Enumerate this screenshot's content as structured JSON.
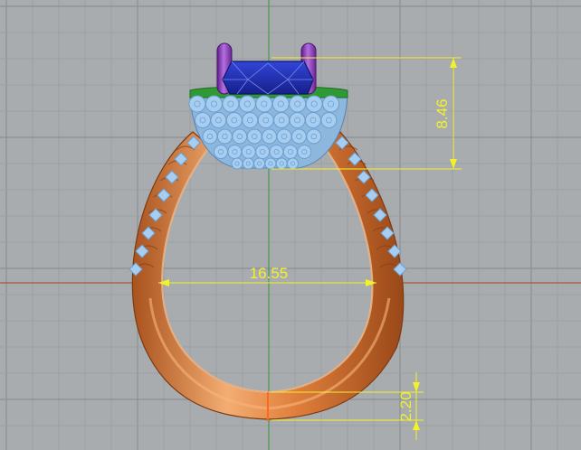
{
  "viewport": {
    "background": "#a9acaf",
    "grid_minor_color": "#9da0a3",
    "grid_major_color": "#8c8f92",
    "axis_y_color": "#3a9a3a",
    "axis_x_color": "#a4451f"
  },
  "colors": {
    "band": "#e07f3c",
    "band_shadow": "#a9521d",
    "band_highlight": "#f3ad72",
    "diamond": "#a7cef1",
    "diamond_line": "#6b9fd0",
    "center_stone": "#2233b6",
    "prong": "#8a38b8",
    "halo_rim": "#2f9a33",
    "dimension": "#f2f22a"
  },
  "dimensions": {
    "height_label": "8.46",
    "width_label": "16.55",
    "shank_label": "2.20"
  }
}
